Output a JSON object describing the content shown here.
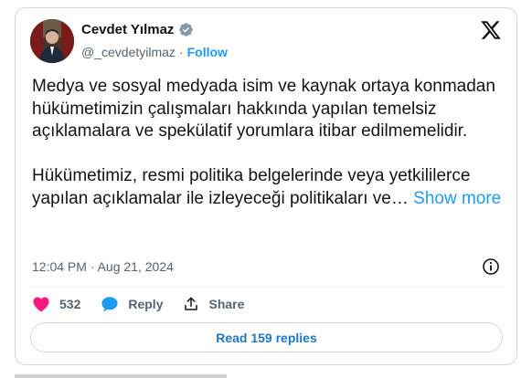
{
  "author": {
    "name": "Cevdet Yılmaz",
    "handle": "@_cevdetyilmaz",
    "separator": "·",
    "follow_label": "Follow"
  },
  "icons": {
    "verified": "verified-badge-icon",
    "platform": "x-logo-icon",
    "info": "info-icon",
    "like": "heart-icon",
    "reply": "speech-bubble-icon",
    "share": "share-icon"
  },
  "post": {
    "text": "Medya ve sosyal medyada isim ve kaynak ortaya konmadan hükümetimizin çalışmaları hakkında yapılan temelsiz açıklamalara ve spekülatif yorumlara itibar edilmemelidir.\n\nHükümetimiz, resmi politika belgelerinde veya yetkililerce yapılan açıklamalar ile izleyeceği politikaları ve… ",
    "show_more_label": "Show more",
    "timestamp": "12:04 PM · Aug 21, 2024"
  },
  "actions": {
    "like_count": "532",
    "reply_label": "Reply",
    "share_label": "Share"
  },
  "read_replies_label": "Read 159 replies",
  "colors": {
    "accent": "#1d9bf0",
    "like": "#f91880",
    "text": "#0f1419",
    "secondary": "#536471",
    "border": "#cfd9de"
  }
}
